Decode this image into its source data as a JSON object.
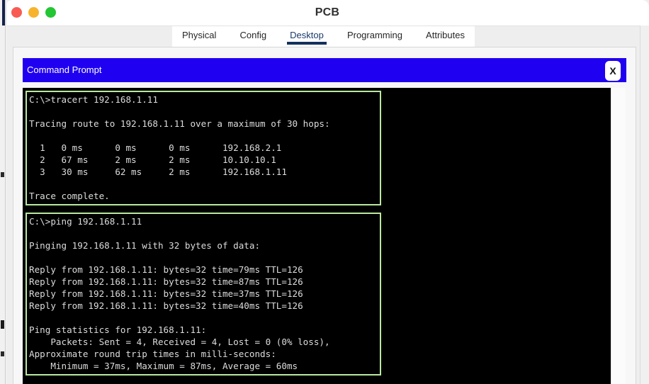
{
  "window": {
    "title": "PCB",
    "traffic_lights": [
      {
        "name": "close",
        "color": "#f85b52"
      },
      {
        "name": "minimize",
        "color": "#f8b32c"
      },
      {
        "name": "maximize",
        "color": "#23c633"
      }
    ]
  },
  "tabs": {
    "active": "Desktop",
    "items": [
      {
        "label": "Physical",
        "active": false
      },
      {
        "label": "Config",
        "active": false
      },
      {
        "label": "Desktop",
        "active": true
      },
      {
        "label": "Programming",
        "active": false
      },
      {
        "label": "Attributes",
        "active": false
      }
    ]
  },
  "command_prompt": {
    "title": "Command Prompt",
    "close_label": "X",
    "header_color": "#2000f0",
    "terminal_bg": "#000000",
    "terminal_text_color": "#dcdcdc",
    "block_border_color": "#b9e8a0",
    "blocks": [
      {
        "name": "tracert-output",
        "command": "C:\\>tracert 192.168.1.11",
        "text": "C:\\>tracert 192.168.1.11\n\nTracing route to 192.168.1.11 over a maximum of 30 hops:\n\n  1   0 ms      0 ms      0 ms      192.168.2.1\n  2   67 ms     2 ms      2 ms      10.10.10.1\n  3   30 ms     62 ms     2 ms      192.168.1.11\n\nTrace complete.",
        "target": "192.168.1.11",
        "max_hops": 30,
        "hops": [
          {
            "hop": 1,
            "rtt1": "0 ms",
            "rtt2": "0 ms",
            "rtt3": "0 ms",
            "address": "192.168.2.1"
          },
          {
            "hop": 2,
            "rtt1": "67 ms",
            "rtt2": "2 ms",
            "rtt3": "2 ms",
            "address": "10.10.10.1"
          },
          {
            "hop": 3,
            "rtt1": "30 ms",
            "rtt2": "62 ms",
            "rtt3": "2 ms",
            "address": "192.168.1.11"
          }
        ],
        "footer": "Trace complete."
      },
      {
        "name": "ping-output",
        "command": "C:\\>ping 192.168.1.11",
        "text": "C:\\>ping 192.168.1.11\n\nPinging 192.168.1.11 with 32 bytes of data:\n\nReply from 192.168.1.11: bytes=32 time=79ms TTL=126\nReply from 192.168.1.11: bytes=32 time=87ms TTL=126\nReply from 192.168.1.11: bytes=32 time=37ms TTL=126\nReply from 192.168.1.11: bytes=32 time=40ms TTL=126\n\nPing statistics for 192.168.1.11:\n    Packets: Sent = 4, Received = 4, Lost = 0 (0% loss),\nApproximate round trip times in milli-seconds:\n    Minimum = 37ms, Maximum = 87ms, Average = 60ms",
        "target": "192.168.1.11",
        "packet_bytes": 32,
        "replies": [
          {
            "from": "192.168.1.11",
            "bytes": 32,
            "time": "79ms",
            "ttl": 126
          },
          {
            "from": "192.168.1.11",
            "bytes": 32,
            "time": "87ms",
            "ttl": 126
          },
          {
            "from": "192.168.1.11",
            "bytes": 32,
            "time": "37ms",
            "ttl": 126
          },
          {
            "from": "192.168.1.11",
            "bytes": 32,
            "time": "40ms",
            "ttl": 126
          }
        ],
        "statistics": {
          "sent": 4,
          "received": 4,
          "lost": 0,
          "loss_percent": "0%",
          "minimum": "37ms",
          "maximum": "87ms",
          "average": "60ms"
        }
      }
    ]
  }
}
